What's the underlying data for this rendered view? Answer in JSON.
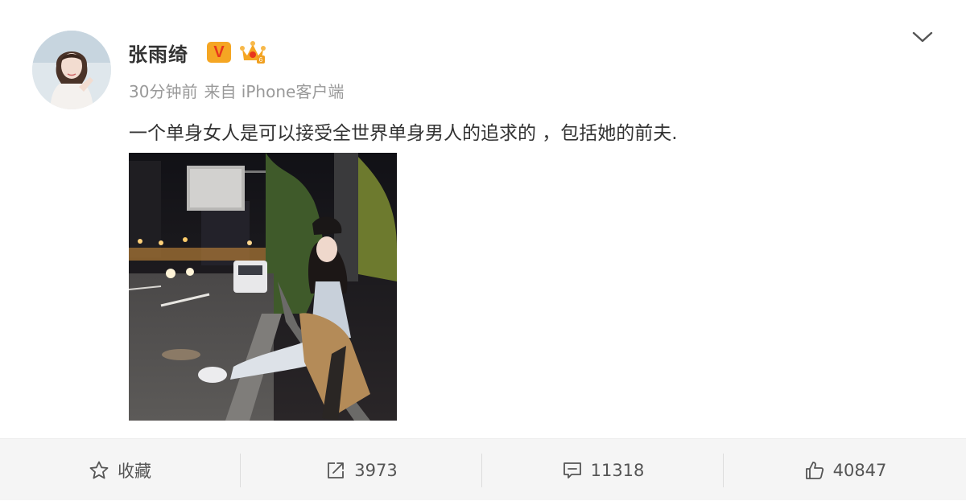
{
  "post": {
    "username": "张雨绮",
    "verified_label": "V",
    "time": "30分钟前",
    "source": "来自 iPhone客户端",
    "text": "一个单身女人是可以接受全世界单身男人的追求的 ，包括她的前夫."
  },
  "icons": {
    "verified": "verified-v-icon",
    "vip": "crown-level-icon",
    "menu": "chevron-down-icon",
    "favorite": "star-icon",
    "repost": "share-arrow-icon",
    "comment": "comment-icon",
    "like": "thumbs-up-icon"
  },
  "actions": {
    "favorite_label": "收藏",
    "repost_count": "3973",
    "comment_count": "11318",
    "like_count": "40847"
  },
  "colors": {
    "verified_badge": "#f5a623",
    "verified_letter": "#e8361c",
    "meta_text": "#999999",
    "action_bar_bg": "#f5f5f5"
  }
}
